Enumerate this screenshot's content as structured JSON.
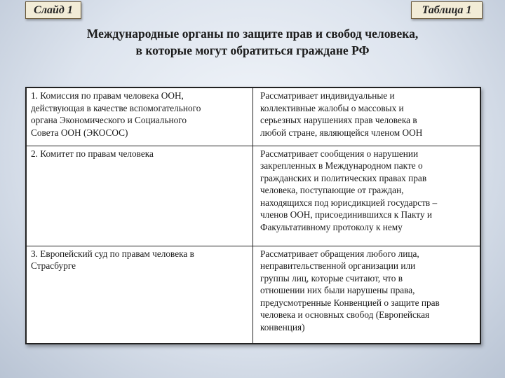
{
  "slide_label": "Слайд 1",
  "table_label": "Таблица 1",
  "title": {
    "line1": "Международные органы по защите прав и свобод человека,",
    "line2": "в которые могут обратиться граждане РФ"
  },
  "rows": [
    {
      "body_lines": [
        "1. Комиссия по правам человека ООН,",
        "действующая в качестве вспомогательного",
        "органа Экономического и Социального",
        "Совета ООН (ЭКОСОС)"
      ],
      "role_lines": [
        "Рассматривает индивидуальные и",
        "коллективные жалобы о массовых и",
        "серьезных нарушениях прав человека в",
        "любой стране, являющейся членом ООН"
      ]
    },
    {
      "body_lines": [
        "2. Комитет по правам человека"
      ],
      "role_lines": [
        "Рассматривает сообщения о нарушении",
        "закрепленных в Международном пакте о",
        "гражданских и политических правах прав",
        "человека, поступающие от граждан,",
        "находящихся под юрисдикцией государств –",
        "членов ООН, присоединившихся к Пакту и",
        "Факультативному протоколу к нему"
      ]
    },
    {
      "body_lines": [
        "3. Европейский суд по правам человека в",
        "Страсбурге"
      ],
      "role_lines": [
        "Рассматривает обращения любого лица,",
        "неправительственной организации или",
        "группы лиц, которые считают, что в",
        "отношении них были нарушены права,",
        "предусмотренные Конвенцией о защите прав",
        "человека и основных свобод (Европейская",
        "конвенция)"
      ]
    }
  ]
}
